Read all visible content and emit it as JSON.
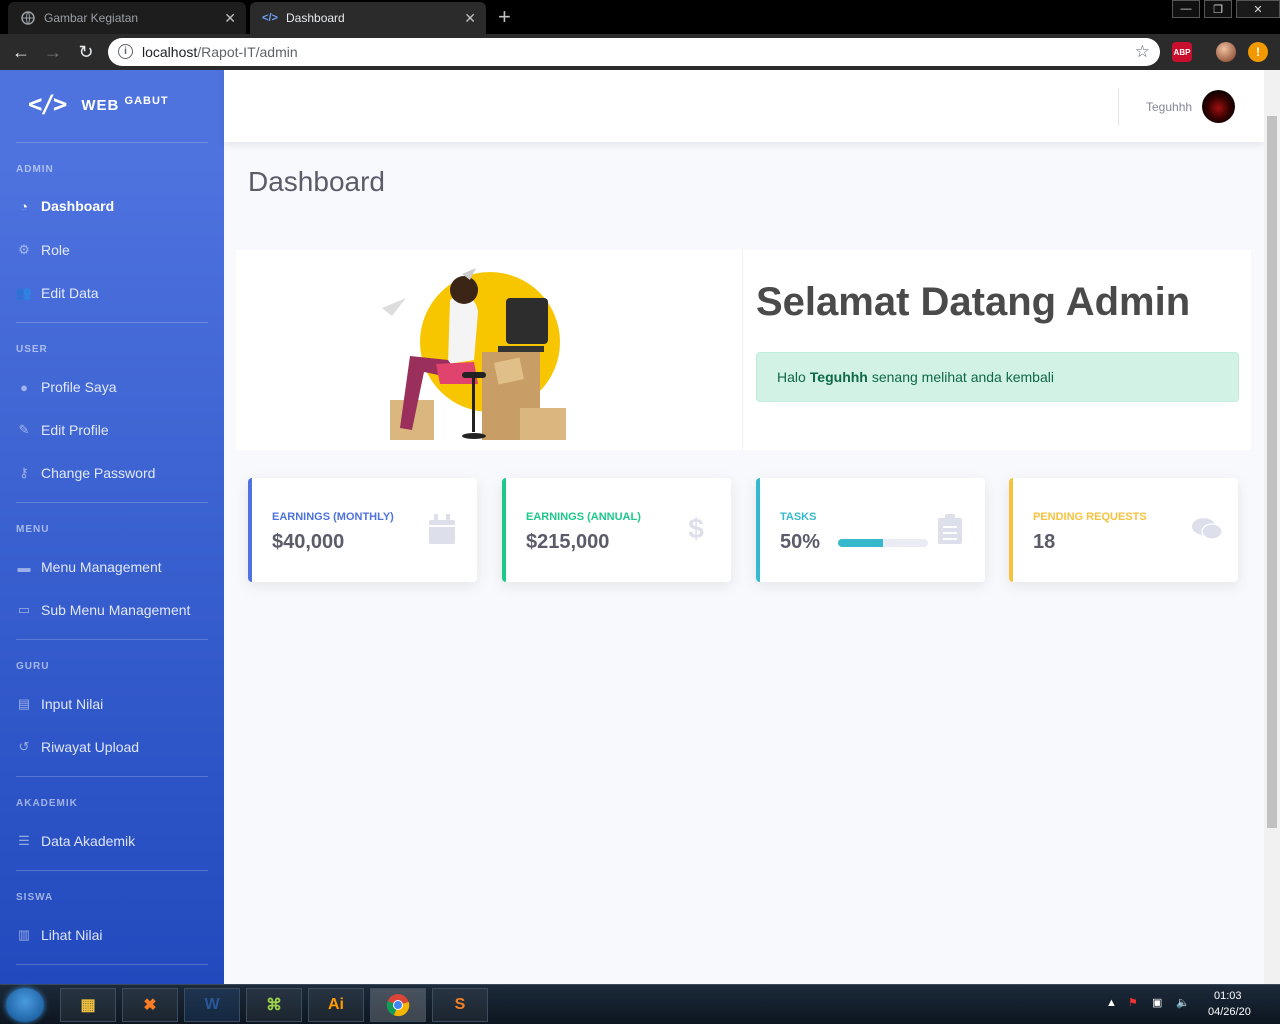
{
  "browser": {
    "tabs": [
      {
        "title": "Gambar Kegiatan",
        "active": false
      },
      {
        "title": "Dashboard",
        "active": true
      }
    ],
    "new_tab": "+",
    "url_host": "localhost",
    "url_path": "/Rapot-IT/admin",
    "extensions": [
      "ABP"
    ]
  },
  "sidebar": {
    "brand": {
      "logo": "</>",
      "word": "WEB",
      "sup": "GABUT"
    },
    "sections": [
      {
        "heading": "ADMIN",
        "items": [
          {
            "label": "Dashboard",
            "icon": "tachometer-icon",
            "active": true
          },
          {
            "label": "Role",
            "icon": "users-cog-icon"
          },
          {
            "label": "Edit Data",
            "icon": "users-icon"
          }
        ]
      },
      {
        "heading": "USER",
        "items": [
          {
            "label": "Profile Saya",
            "icon": "user-icon"
          },
          {
            "label": "Edit Profile",
            "icon": "user-edit-icon"
          },
          {
            "label": "Change Password",
            "icon": "key-icon"
          }
        ]
      },
      {
        "heading": "MENU",
        "items": [
          {
            "label": "Menu Management",
            "icon": "folder-icon"
          },
          {
            "label": "Sub Menu Management",
            "icon": "folder-open-icon"
          }
        ]
      },
      {
        "heading": "GURU",
        "items": [
          {
            "label": "Input Nilai",
            "icon": "book-icon"
          },
          {
            "label": "Riwayat Upload",
            "icon": "history-icon"
          }
        ]
      },
      {
        "heading": "AKADEMIK",
        "items": [
          {
            "label": "Data Akademik",
            "icon": "database-icon"
          }
        ]
      },
      {
        "heading": "SISWA",
        "items": [
          {
            "label": "Lihat Nilai",
            "icon": "book-open-icon"
          }
        ]
      }
    ]
  },
  "topbar": {
    "username": "Teguhhh"
  },
  "page": {
    "title": "Dashboard",
    "welcome_title": "Selamat Datang Admin",
    "alert_prefix": "Halo",
    "alert_name": "Teguhhh",
    "alert_suffix": "senang melihat anda kembali"
  },
  "cards": [
    {
      "label": "Earnings (Monthly)",
      "value": "$40,000",
      "color": "#4e73df",
      "icon": "calendar-icon"
    },
    {
      "label": "Earnings (Annual)",
      "value": "$215,000",
      "color": "#1cc88a",
      "icon": "dollar-icon"
    },
    {
      "label": "Tasks",
      "value": "50%",
      "color": "#36b9cc",
      "icon": "clipboard-list-icon",
      "progress": 0.5
    },
    {
      "label": "Pending Requests",
      "value": "18",
      "color": "#f6c23e",
      "icon": "comments-icon"
    }
  ],
  "taskbar": {
    "apps": [
      "explorer",
      "xampp",
      "word",
      "network",
      "illustrator",
      "chrome",
      "sublime"
    ],
    "clock_time": "01:03",
    "clock_date": "04/26/20"
  }
}
